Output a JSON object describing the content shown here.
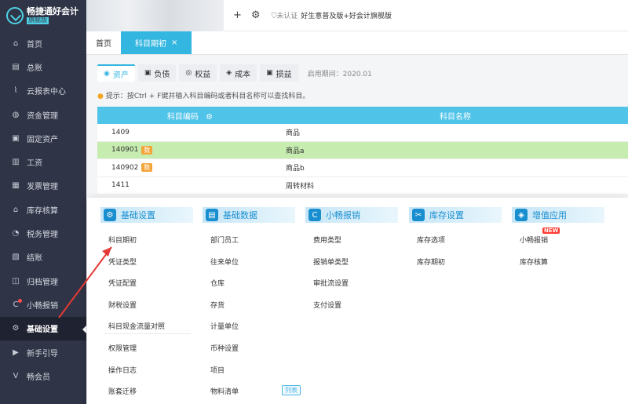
{
  "sidebar": {
    "logo_title": "畅捷通好会计",
    "logo_sub": "旗舰版",
    "items": [
      {
        "label": "首页",
        "icon": "home-icon",
        "glyph": "⌂"
      },
      {
        "label": "总账",
        "icon": "ledger-icon",
        "glyph": "▤"
      },
      {
        "label": "云报表中心",
        "icon": "chart-icon",
        "glyph": "⌇"
      },
      {
        "label": "资金管理",
        "icon": "money-icon",
        "glyph": "◍"
      },
      {
        "label": "固定资产",
        "icon": "asset-icon",
        "glyph": "▣"
      },
      {
        "label": "工资",
        "icon": "salary-icon",
        "glyph": "▥"
      },
      {
        "label": "发票管理",
        "icon": "invoice-icon",
        "glyph": "▦"
      },
      {
        "label": "库存核算",
        "icon": "inventory-icon",
        "glyph": "⌂"
      },
      {
        "label": "税务管理",
        "icon": "tax-icon",
        "glyph": "◔"
      },
      {
        "label": "结账",
        "icon": "close-account-icon",
        "glyph": "▧"
      },
      {
        "label": "归档管理",
        "icon": "archive-icon",
        "glyph": "◫"
      },
      {
        "label": "小畅报销",
        "icon": "reimburse-icon",
        "glyph": "C"
      },
      {
        "label": "基础设置",
        "icon": "gear-icon",
        "glyph": "⚙"
      },
      {
        "label": "新手引导",
        "icon": "guide-icon",
        "glyph": "▶"
      },
      {
        "label": "畅会员",
        "icon": "member-icon",
        "glyph": "V"
      }
    ]
  },
  "topbar": {
    "add_glyph": "+",
    "settings_glyph": "⚙",
    "cert_status": "未认证",
    "promo": "好生意普及版+好会计旗舰版"
  },
  "tabs": {
    "home": "首页",
    "active": "科目期初",
    "close_glyph": "×"
  },
  "categories": [
    {
      "label": "资产",
      "glyph": "◉"
    },
    {
      "label": "负债",
      "glyph": "▣"
    },
    {
      "label": "权益",
      "glyph": "◎"
    },
    {
      "label": "成本",
      "glyph": "◈"
    },
    {
      "label": "损益",
      "glyph": "▣"
    }
  ],
  "open_date": "启用期间：2020.01",
  "hint": "提示：按Ctrl + F键并输入科目编码或者科目名称可以查找科目。",
  "hint_glyph": "●",
  "table": {
    "col_code": "科目编码",
    "col_name": "科目名称",
    "gear_glyph": "⚙",
    "rows": [
      {
        "code": "1409",
        "badge": "",
        "name": "商品"
      },
      {
        "code": "140901",
        "badge": "数",
        "name": "商品a"
      },
      {
        "code": "140902",
        "badge": "数",
        "name": "商品b"
      },
      {
        "code": "1411",
        "badge": "",
        "name": "周转材料"
      }
    ]
  },
  "menu": {
    "columns": [
      {
        "title": "基础设置",
        "glyph": "⚙",
        "items": [
          "科目期初",
          "凭证类型",
          "凭证配置",
          "财税设置",
          "科目现金流量对照",
          "权限管理",
          "操作日志",
          "账套迁移"
        ]
      },
      {
        "title": "基础数据",
        "glyph": "▤",
        "items": [
          "部门员工",
          "往来单位",
          "仓库",
          "存货",
          "计量单位",
          "币种设置",
          "项目",
          "物料清单"
        ]
      },
      {
        "title": "小畅报销",
        "glyph": "C",
        "items": [
          "费用类型",
          "报销单类型",
          "审批流设置",
          "支付设置"
        ]
      },
      {
        "title": "库存设置",
        "glyph": "✂",
        "items": [
          "库存选项",
          "库存期初"
        ]
      },
      {
        "title": "增值应用",
        "glyph": "◈",
        "items": [
          "小畅报销",
          "库存核算"
        ]
      }
    ],
    "new_badge": "NEW",
    "list_tag": "列表"
  }
}
